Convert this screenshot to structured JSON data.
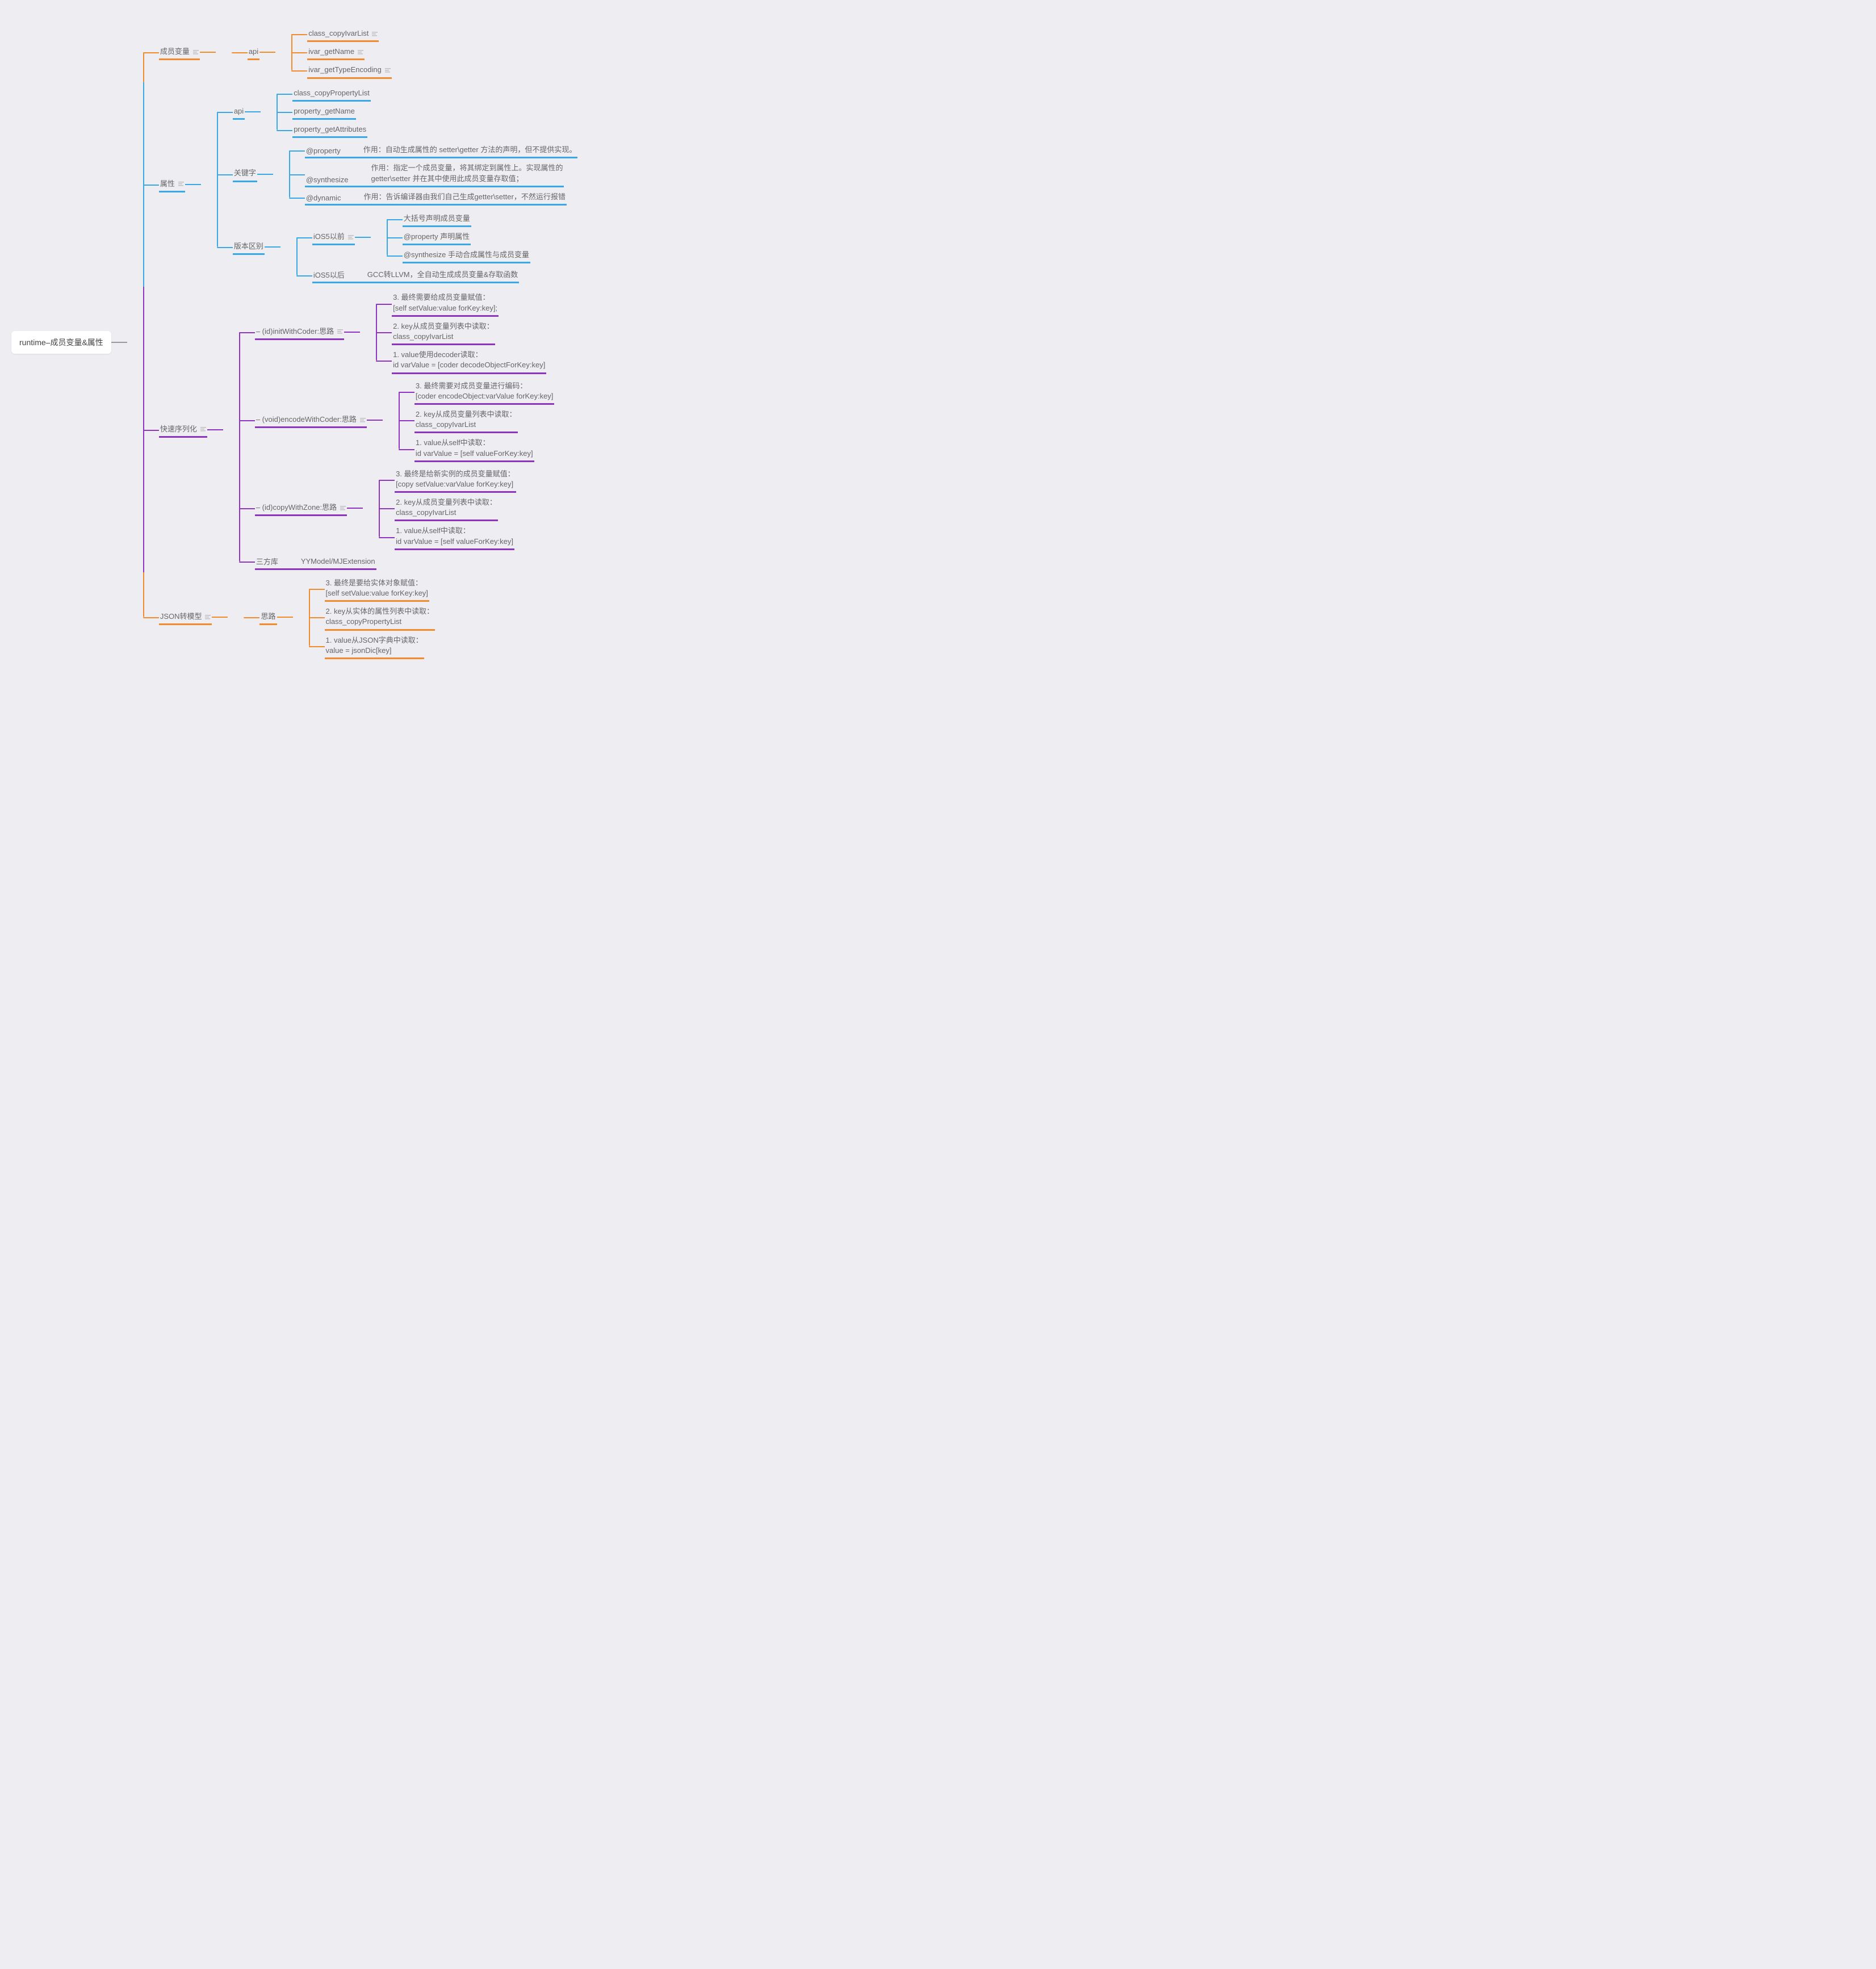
{
  "root": "runtime–成员变量&属性",
  "b1": {
    "label": "成员变量",
    "api": "api",
    "items": [
      "class_copyIvarList",
      "ivar_getName",
      "ivar_getTypeEncoding"
    ]
  },
  "b2": {
    "label": "属性",
    "api": {
      "label": "api",
      "items": [
        "class_copyPropertyList",
        "property_getName",
        "property_getAttributes"
      ]
    },
    "kw": {
      "label": "关键字",
      "rows": [
        {
          "k": "@property",
          "v": "作用：自动生成属性的 setter\\getter 方法的声明，但不提供实现。"
        },
        {
          "k": "@synthesize",
          "v": "作用：指定一个成员变量，将其绑定到属性上。实现属性的\ngetter\\setter 并在其中使用此成员变量存取值；"
        },
        {
          "k": "@dynamic",
          "v": "作用：告诉编译器由我们自己生成getter\\setter，不然运行报错"
        }
      ]
    },
    "ver": {
      "label": "版本区别",
      "pre": {
        "label": "iOS5以前",
        "items": [
          "大括号声明成员变量",
          "@property 声明属性",
          "@synthesize 手动合成属性与成员变量"
        ]
      },
      "post": {
        "label": "iOS5以后",
        "value": "GCC转LLVM，全自动生成成员变量&存取函数"
      }
    }
  },
  "b3": {
    "label": "快速序列化",
    "m1": {
      "label": "– (id)initWithCoder:思路",
      "items": [
        "3. 最终需要给成员变量赋值：\n[self setValue:value forKey:key];",
        "2. key从成员变量列表中读取：\nclass_copyIvarList",
        "1. value使用decoder读取：\nid varValue = [coder decodeObjectForKey:key]"
      ]
    },
    "m2": {
      "label": "– (void)encodeWithCoder:思路",
      "items": [
        "3. 最终需要对成员变量进行编码：\n[coder encodeObject:varValue forKey:key]",
        "2. key从成员变量列表中读取：\nclass_copyIvarList",
        "1. value从self中读取：\nid varValue = [self valueForKey:key]"
      ]
    },
    "m3": {
      "label": "– (id)copyWithZone:思路",
      "items": [
        "3. 最终是给新实例的成员变量赋值：\n[copy setValue:varValue forKey:key]",
        "2. key从成员变量列表中读取：\nclass_copyIvarList",
        "1. value从self中读取：\nid varValue = [self valueForKey:key]"
      ]
    },
    "lib": {
      "label": "三方库",
      "value": "YYModel/MJExtension"
    }
  },
  "b4": {
    "label": "JSON转模型",
    "idea": {
      "label": "思路",
      "items": [
        "3. 最终是要给实体对象赋值：\n[self setValue:value forKey:key]",
        "2. key从实体的属性列表中读取：\nclass_copyPropertyList",
        "1. value从JSON字典中读取：\nvalue = jsonDic[key]"
      ]
    }
  }
}
